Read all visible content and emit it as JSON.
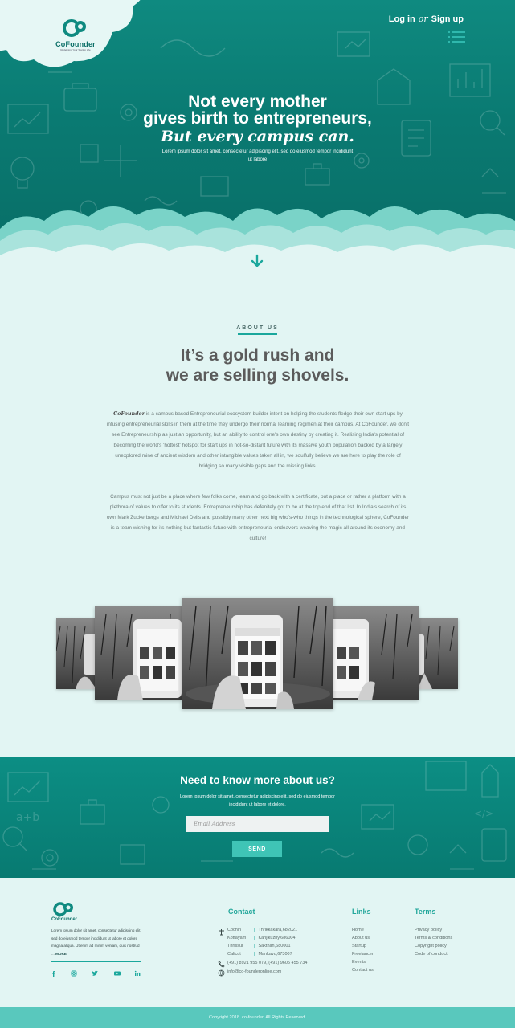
{
  "brand": {
    "name": "CoFounder",
    "tagline": "Redefining Your Startup Life"
  },
  "auth": {
    "login": "Log in",
    "or": "or",
    "signup": "Sign up"
  },
  "hero": {
    "line1": "Not every mother",
    "line2": "gives birth to entrepreneurs,",
    "line3": "But every campus can.",
    "subtext": "Lorem ipsum dolor sit amet, consectetur adipiscing elit, sed do eiusmod tempor incididunt ut labore"
  },
  "about": {
    "tag": "ABOUT US",
    "title_line1": "It’s a gold rush and",
    "title_line2": "we are selling shovels.",
    "p1_brand": "CoFounder",
    "p1": " is a campus based Entrepreneurial ecosystem builder intent on helping the students fledge their own start ups by infusing entrepreneurial skills in them at the time they undergo their normal learning regimen at their campus. At CoFounder, we don't see Entrepreneurship as just an opportunity, but an ability to control one's own destiny by creating it. Realising India's potential of becoming the world's 'hottest' hotspot for start ups in not-so-distant future with its massive youth population backed by a largely unexplored mine of ancient wisdom and other intangible values taken all in, we soulfully believe we are here to play the role of bridging so many visible gaps and the missing links.",
    "p2": "Campus must not just be a place where few folks come, learn and go back with a certificate, but a place or rather a platform with a plethora of values to offer to its students. Entrepreneurship has defenitely got to be at the top end of that list. In India's search of its own Mark Zuckerbergs and Michael Dells and possibly many other next big who's-who things in the technological sphere, CoFounder is a team wishing for its nothing but fantastic future with entrepreneurial endeavors weaving the magic all around its economy and culture!"
  },
  "newsletter": {
    "title": "Need to know more about us?",
    "subtext": "Lorem ipsum dolor sit amet, consectetur adipiscing elit, sed do eiusmod tempor incididunt ut labore et dolore.",
    "placeholder": "Email Address",
    "button": "SEND"
  },
  "footer": {
    "logo_name": "CoFounder",
    "description": "Lorem ipsum dolor sit amet, consectetur adipiscing elit, sed do eiusmod tempor incididunt ut labore et dolore magna aliqua. Ut enim ad minim veniam, quis nostrud ....",
    "more": "MORE",
    "contact_title": "Contact",
    "locations": [
      {
        "city": "Cochin",
        "place": "Thrikkakara,682021"
      },
      {
        "city": "Kottayam",
        "place": "Kanjikuzhy,686004"
      },
      {
        "city": "Thrissur",
        "place": "Sakthan,680001"
      },
      {
        "city": "Calicut",
        "place": "Mankavu,673007"
      }
    ],
    "phone": "(+91) 8921 955 079, (+91) 9605 455 734",
    "email": "info@co-founderonline.com",
    "links_title": "Links",
    "links": [
      "Home",
      "About us",
      "Startup",
      "Freelancer",
      "Events",
      "Contact us"
    ],
    "terms_title": "Terms",
    "terms": [
      "Privacy policy",
      "Terms & conditions",
      "Copyright policy",
      "Code of conduct"
    ],
    "social": [
      "facebook-icon",
      "instagram-icon",
      "twitter-icon",
      "youtube-icon",
      "linkedin-icon"
    ],
    "copyright": "Copyright 2018. co-founder. All Rights Reserved."
  },
  "colors": {
    "primary": "#0a7a72",
    "accent": "#1aa79c",
    "light_bg": "#e2f5f3",
    "button": "#3fc4b6",
    "copyright_bar": "#59c8bd"
  }
}
